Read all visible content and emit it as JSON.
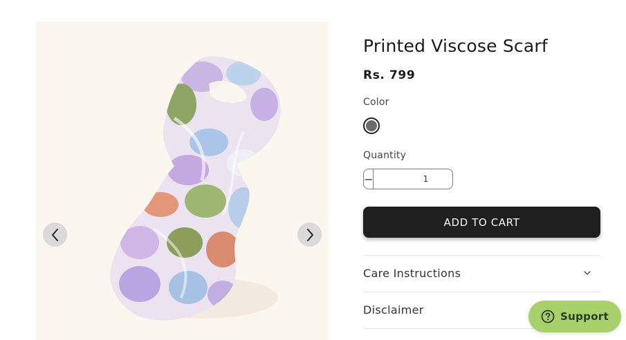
{
  "product": {
    "title": "Printed Viscose Scarf",
    "price": "Rs. 799"
  },
  "color": {
    "label": "Color",
    "selected_swatch": "#6b6b6b"
  },
  "quantity": {
    "label": "Quantity",
    "value": "1",
    "decrement_symbol": "−",
    "increment_symbol": "+"
  },
  "cart": {
    "button_label": "ADD TO CART"
  },
  "accordion": [
    {
      "label": "Care Instructions"
    },
    {
      "label": "Disclaimer"
    }
  ],
  "support": {
    "label": "Support",
    "color": "#a8d16b"
  },
  "icons": {
    "gallery_prev": "chevron-left-icon",
    "gallery_next": "chevron-right-icon",
    "accordion": "chevron-down-icon",
    "support": "help-circle-icon"
  }
}
